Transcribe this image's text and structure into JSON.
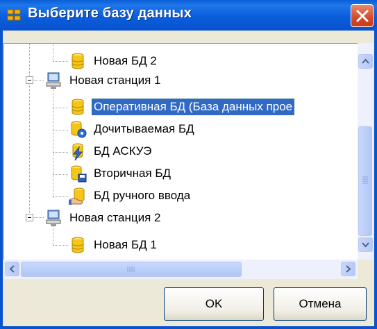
{
  "window": {
    "title": "Выберите базу данных",
    "colors": {
      "titlebar": "#0b5ddc",
      "selection": "#316ac5",
      "close": "#d54a2b"
    }
  },
  "tree": {
    "items": [
      {
        "label": "Новая БД 2",
        "icon": "database-icon",
        "level": 2
      },
      {
        "label": "Новая станция 1",
        "icon": "computer-icon",
        "level": 1,
        "expanded": true
      },
      {
        "label": "Оперативная БД (База данных прое",
        "icon": "database-icon",
        "level": 2,
        "selected": true
      },
      {
        "label": "Дочитываемая БД",
        "icon": "database-gear-icon",
        "level": 2
      },
      {
        "label": "БД АСКУЭ",
        "icon": "database-lightning-icon",
        "level": 2
      },
      {
        "label": "Вторичная БД",
        "icon": "database-disk-icon",
        "level": 2
      },
      {
        "label": "БД ручного ввода",
        "icon": "database-hand-icon",
        "level": 2
      },
      {
        "label": "Новая станция 2",
        "icon": "computer-icon",
        "level": 1,
        "expanded": true
      },
      {
        "label": "Новая БД 1",
        "icon": "database-icon",
        "level": 2
      }
    ]
  },
  "buttons": {
    "ok": "OK",
    "cancel": "Отмена"
  }
}
